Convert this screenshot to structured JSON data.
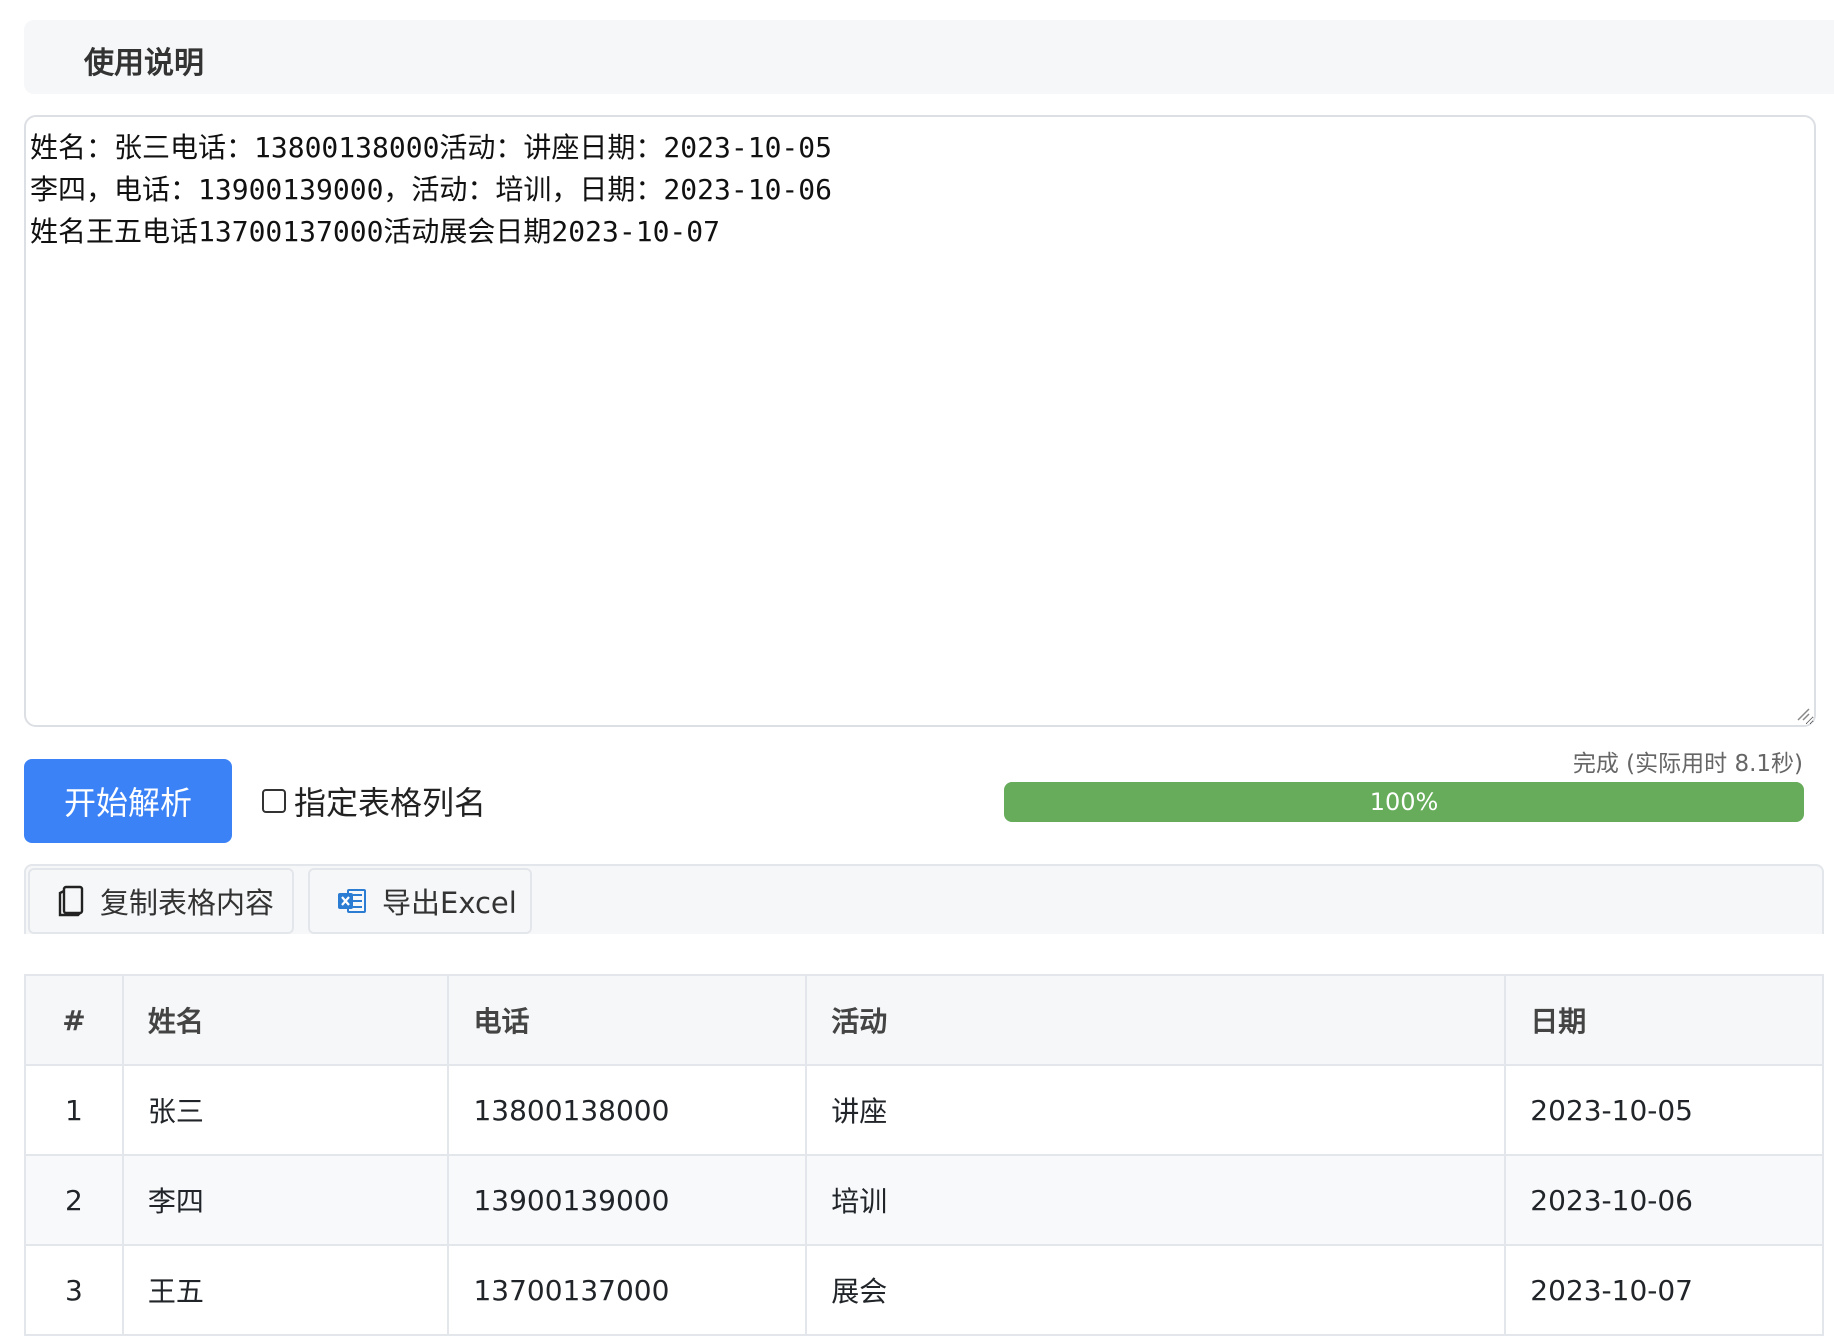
{
  "usage": {
    "title": "使用说明"
  },
  "input": {
    "text": "姓名：张三电话：13800138000活动：讲座日期：2023-10-05\n李四，电话：13900139000，活动：培训，日期：2023-10-06\n姓名王五电话13700137000活动展会日期2023-10-07"
  },
  "controls": {
    "parse_label": "开始解析",
    "column_option_label": "指定表格列名",
    "column_option_checked": false
  },
  "progress": {
    "status": "完成 (实际用时 8.1秒)",
    "percent": 100,
    "label": "100%"
  },
  "toolbar": {
    "copy_label": "复制表格内容",
    "export_label": "导出Excel"
  },
  "table": {
    "headers": [
      "#",
      "姓名",
      "电话",
      "活动",
      "日期"
    ],
    "rows": [
      [
        "1",
        "张三",
        "13800138000",
        "讲座",
        "2023-10-05"
      ],
      [
        "2",
        "李四",
        "13900139000",
        "培训",
        "2023-10-06"
      ],
      [
        "3",
        "王五",
        "13700137000",
        "展会",
        "2023-10-07"
      ]
    ]
  },
  "colors": {
    "primary": "#3b82f6",
    "progress": "#67ac5b",
    "excel_icon": "#2b7cd3"
  }
}
